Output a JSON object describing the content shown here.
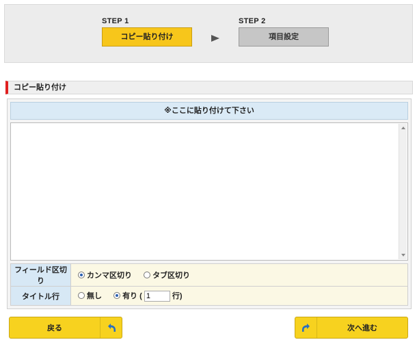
{
  "steps": [
    {
      "label": "STEP 1",
      "name": "コピー貼り付け"
    },
    {
      "label": "STEP 2",
      "name": "項目設定"
    }
  ],
  "section": {
    "title": "コピー貼り付け"
  },
  "paste": {
    "header": "※ここに貼り付けて下さい",
    "value": ""
  },
  "options": {
    "field_sep": {
      "label": "フィールド区切り",
      "choices": [
        "カンマ区切り",
        "タブ区切り"
      ],
      "selected": "カンマ区切り"
    },
    "title_row": {
      "label": "タイトル行",
      "none_label": "無し",
      "yes_label": "有り",
      "open_paren": "(",
      "row_value": "1",
      "row_suffix": "行)",
      "selected": "有り"
    }
  },
  "buttons": {
    "back": "戻る",
    "next": "次へ進む"
  },
  "colors": {
    "accent": "#f7d21f",
    "step_active": "#f7c61b",
    "section_marker": "#e02020",
    "header_blue": "#daeaf6",
    "icon_blue": "#2a6fc0"
  }
}
